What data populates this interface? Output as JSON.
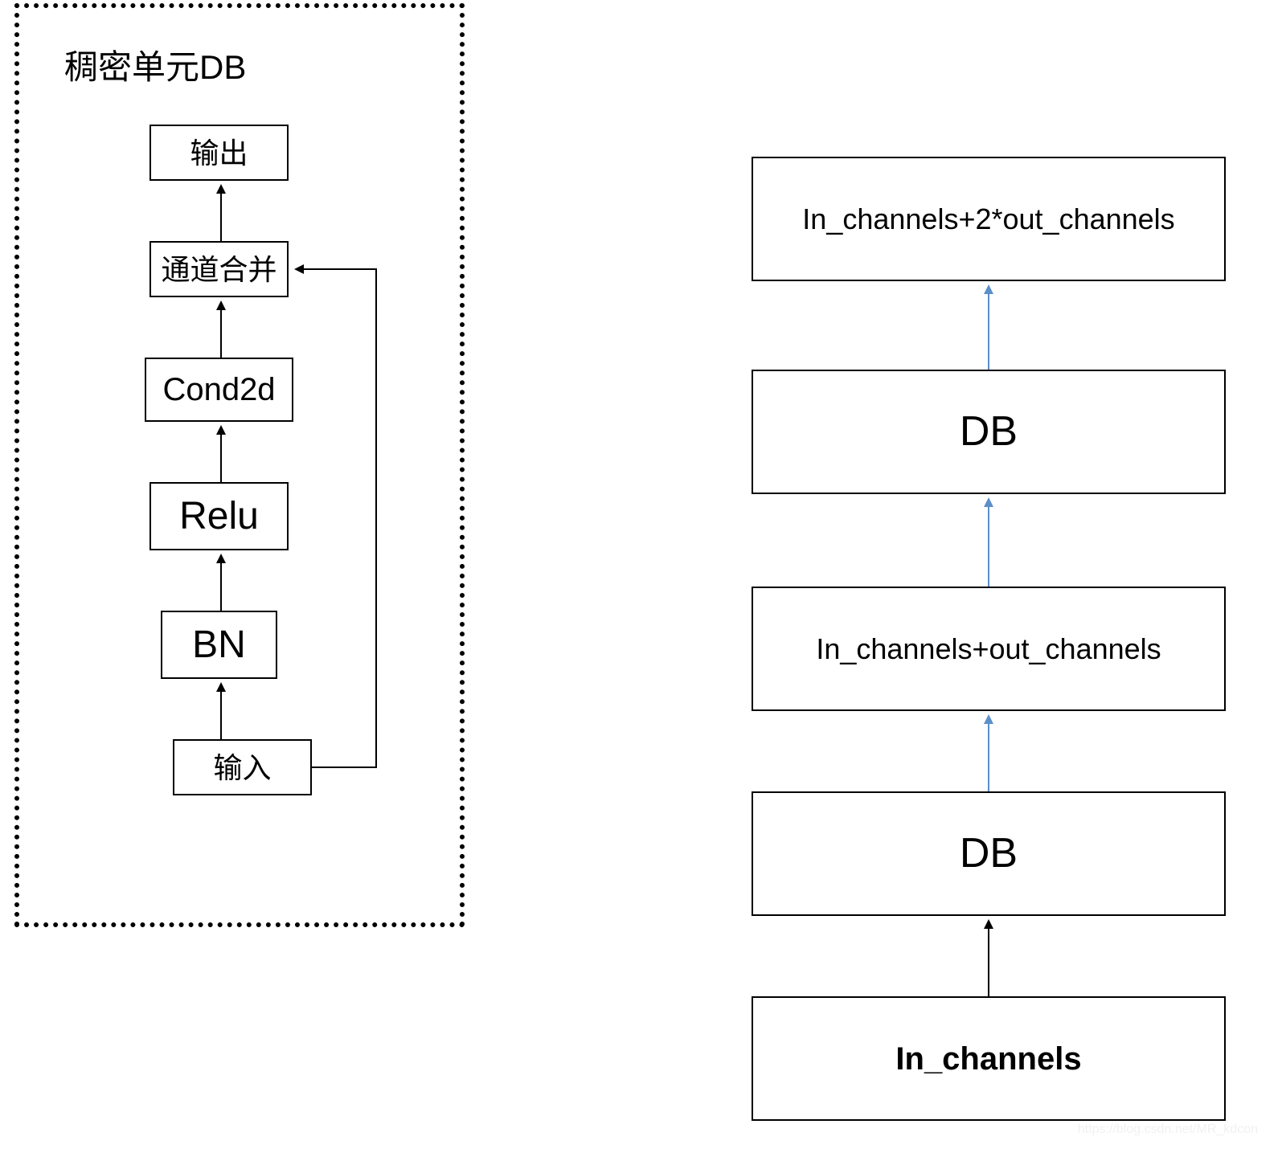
{
  "left": {
    "title": "稠密单元DB",
    "boxes": [
      {
        "key": "out",
        "label": "输出"
      },
      {
        "key": "merge",
        "label": "通道合并"
      },
      {
        "key": "conv",
        "label": "Cond2d"
      },
      {
        "key": "relu",
        "label": "Relu"
      },
      {
        "key": "bn",
        "label": "BN"
      },
      {
        "key": "in",
        "label": "输入"
      }
    ]
  },
  "right": {
    "boxes": [
      {
        "key": "r_top",
        "label": "In_channels+2*out_channels"
      },
      {
        "key": "r_db2",
        "label": "DB"
      },
      {
        "key": "r_mid",
        "label": "In_channels+out_channels"
      },
      {
        "key": "r_db1",
        "label": "DB"
      },
      {
        "key": "r_in",
        "label": "In_channels"
      }
    ]
  },
  "colors": {
    "black": "#000000",
    "blue": "#5b8fc9"
  },
  "watermark": "https://blog.csdn.net/MR_kdcon"
}
